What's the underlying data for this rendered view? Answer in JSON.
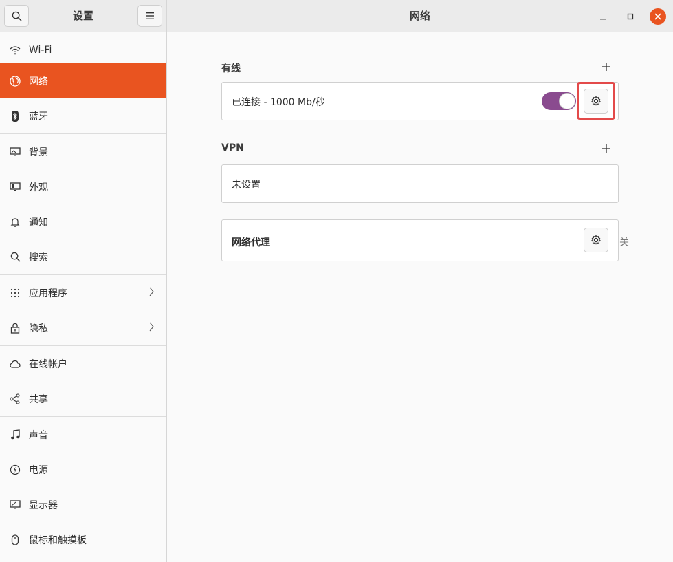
{
  "header": {
    "sidebar_title": "设置",
    "main_title": "网络",
    "icons": {
      "search": "search-icon",
      "menu": "hamburger-menu-icon",
      "minimize": "minimize-icon",
      "maximize": "maximize-icon",
      "close": "close-icon"
    }
  },
  "sidebar": {
    "items": [
      {
        "label": "Wi-Fi",
        "icon": "wifi-icon"
      },
      {
        "label": "网络",
        "icon": "network-globe-icon",
        "active": true
      },
      {
        "label": "蓝牙",
        "icon": "bluetooth-icon"
      },
      {
        "label": "背景",
        "icon": "background-icon"
      },
      {
        "label": "外观",
        "icon": "appearance-icon"
      },
      {
        "label": "通知",
        "icon": "bell-icon"
      },
      {
        "label": "搜索",
        "icon": "search-icon"
      },
      {
        "label": "应用程序",
        "icon": "apps-grid-icon",
        "has_submenu": true
      },
      {
        "label": "隐私",
        "icon": "lock-icon",
        "has_submenu": true
      },
      {
        "label": "在线帐户",
        "icon": "cloud-icon"
      },
      {
        "label": "共享",
        "icon": "share-icon"
      },
      {
        "label": "声音",
        "icon": "music-note-icon"
      },
      {
        "label": "电源",
        "icon": "power-icon"
      },
      {
        "label": "显示器",
        "icon": "display-icon"
      },
      {
        "label": "鼠标和触摸板",
        "icon": "mouse-icon"
      }
    ]
  },
  "main": {
    "wired": {
      "title": "有线",
      "status": "已连接 - 1000 Mb/秒",
      "enabled": true
    },
    "vpn": {
      "title": "VPN",
      "status": "未设置"
    },
    "proxy": {
      "label": "网络代理",
      "state": "关"
    }
  },
  "colors": {
    "accent": "#e95420",
    "toggle_on": "#8a4b8f",
    "highlight": "#e34a4a"
  }
}
